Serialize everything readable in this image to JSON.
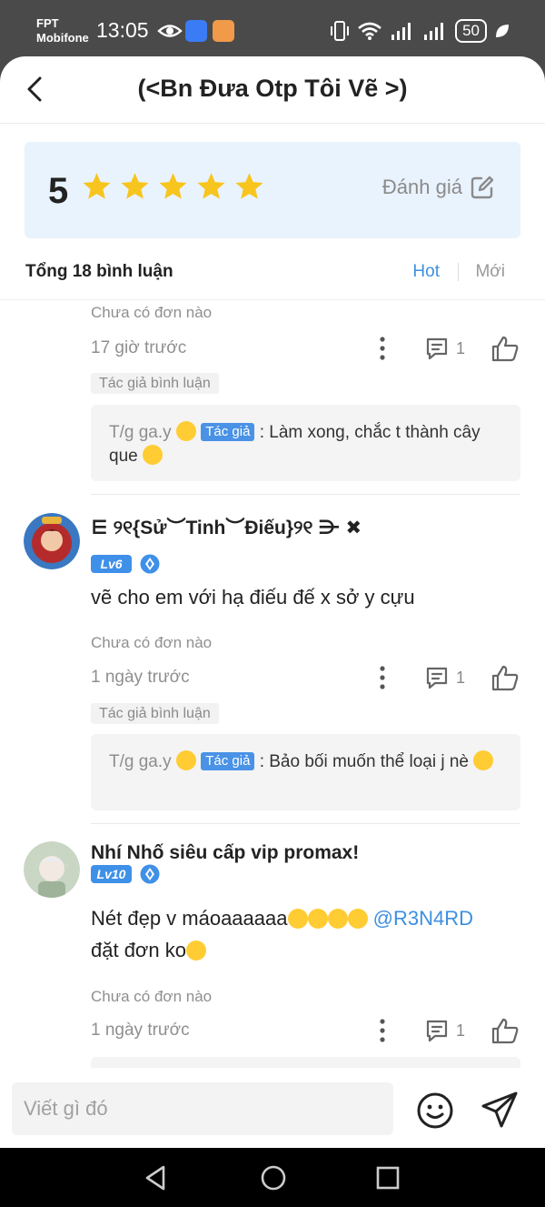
{
  "status_bar": {
    "carrier_line1": "FPT",
    "carrier_line2": "Mobifone",
    "time": "13:05",
    "app_badge": "Vinh Mobile",
    "battery": "50"
  },
  "header": {
    "title": "(<Bn Đưa Otp Tôi Vẽ >)"
  },
  "rating": {
    "score": "5",
    "stars": 5,
    "rate_label": "Đánh giá",
    "star_color": "#f7c51e"
  },
  "tabs": {
    "total": "Tổng 18 bình luận",
    "hot": "Hot",
    "new": "Mới"
  },
  "comments": [
    {
      "no_order": "Chưa có đơn nào",
      "time": "17 giờ trước",
      "reply_count": "1",
      "author_badge": "Tác giả bình luận",
      "reply": {
        "author": "T/g ga.y",
        "tag": "Tác giả",
        "text": ": Làm xong, chắc t thành cây que"
      }
    },
    {
      "username": "⋿ ୨୧{Sử︶Tinh︶Điếu}୨୧ ⋺ ✖",
      "level": "Lv6",
      "text": "vẽ cho em với hạ điếu đế x sở y cựu",
      "no_order": "Chưa có đơn nào",
      "time": "1 ngày trước",
      "reply_count": "1",
      "author_badge": "Tác giả bình luận",
      "reply": {
        "author": "T/g ga.y",
        "tag": "Tác giả",
        "text": ": Bảo bối muốn thể loại j nè"
      }
    },
    {
      "username": "Nhí Nhố siêu cấp vip promax!",
      "level": "Lv10",
      "text": "Nét đẹp v máoaaaaaa",
      "mention": "@R3N4RD",
      "text2": "đặt đơn ko",
      "no_order": "Chưa có đơn nào",
      "time": "1 ngày trước",
      "reply_count": "1"
    }
  ],
  "composer": {
    "placeholder": "Viết gì đó"
  },
  "colors": {
    "accent": "#3d8fe0",
    "rating_bg": "#e9f3fd"
  }
}
